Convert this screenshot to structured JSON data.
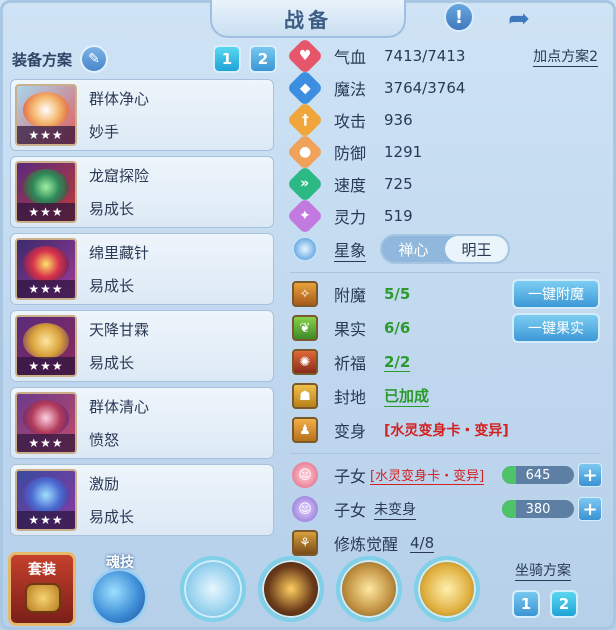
{
  "window": {
    "title": "战备"
  },
  "colors": {
    "accent": "#3b95d4",
    "green_value": "#2d9a2d",
    "red_value": "#d42222"
  },
  "header_icons": [
    "info-icon",
    "share-icon"
  ],
  "left_panel": {
    "title": "装备方案",
    "plan_buttons": [
      "1",
      "2"
    ],
    "skills": [
      {
        "name": "群体净心",
        "sub": "妙手",
        "stars": "★★★"
      },
      {
        "name": "龙窟探险",
        "sub": "易成长",
        "stars": "★★★"
      },
      {
        "name": "绵里藏针",
        "sub": "易成长",
        "stars": "★★★"
      },
      {
        "name": "天降甘霖",
        "sub": "易成长",
        "stars": "★★★"
      },
      {
        "name": "群体清心",
        "sub": "愤怒",
        "stars": "★★★"
      },
      {
        "name": "激励",
        "sub": "易成长",
        "stars": "★★★"
      }
    ]
  },
  "stats": {
    "plan_link": "加点方案2",
    "rows": [
      {
        "label": "气血",
        "value": "7413/7413",
        "icon": "heart-icon",
        "color": "#e5566b"
      },
      {
        "label": "魔法",
        "value": "3764/3764",
        "icon": "mana-icon",
        "color": "#3c8fe0"
      },
      {
        "label": "攻击",
        "value": "936",
        "icon": "attack-icon",
        "color": "#f0a63a"
      },
      {
        "label": "防御",
        "value": "1291",
        "icon": "defense-icon",
        "color": "#f0a25a"
      },
      {
        "label": "速度",
        "value": "725",
        "icon": "speed-icon",
        "color": "#2cb983"
      },
      {
        "label": "灵力",
        "value": "519",
        "icon": "spirit-icon",
        "color": "#c27ae0"
      }
    ]
  },
  "star_sign": {
    "label": "星象",
    "options": [
      "禅心",
      "明王"
    ],
    "selected": "明王"
  },
  "features": [
    {
      "label": "附魔",
      "value": "5/5",
      "button": "一键附魔"
    },
    {
      "label": "果实",
      "value": "6/6",
      "button": "一键果实"
    },
    {
      "label": "祈福",
      "value": "2/2"
    },
    {
      "label": "封地",
      "value": "已加成"
    },
    {
      "label": "变身",
      "value": "[水灵变身卡・变异]"
    }
  ],
  "children": [
    {
      "label": "子女",
      "value": "[水灵变身卡・变异]",
      "points": "645"
    },
    {
      "label": "子女",
      "value": "未变身",
      "points": "380"
    }
  ],
  "cultivation": {
    "label": "修炼觉醒",
    "value": "4/8"
  },
  "bottom": {
    "suit_label": "套装",
    "soul_label": "魂技",
    "mount_label": "坐骑方案",
    "mount_buttons": [
      "1",
      "2"
    ]
  }
}
